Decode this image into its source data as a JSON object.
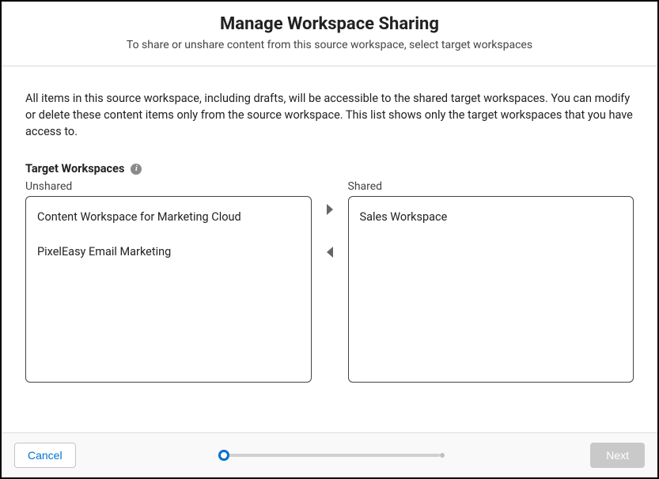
{
  "header": {
    "title": "Manage Workspace Sharing",
    "subtitle": "To share or unshare content from this source workspace, select target workspaces"
  },
  "body": {
    "description": "All items in this source workspace, including drafts, will be accessible to the shared target workspaces. You can modify or delete these content items only from the source workspace. This list shows only the target workspaces that you have access to.",
    "section_label": "Target Workspaces"
  },
  "lists": {
    "unshared_label": "Unshared",
    "shared_label": "Shared",
    "unshared_items": [
      "Content Workspace for Marketing Cloud",
      "PixelEasy Email Marketing"
    ],
    "shared_items": [
      "Sales Workspace"
    ]
  },
  "footer": {
    "cancel": "Cancel",
    "next": "Next"
  }
}
